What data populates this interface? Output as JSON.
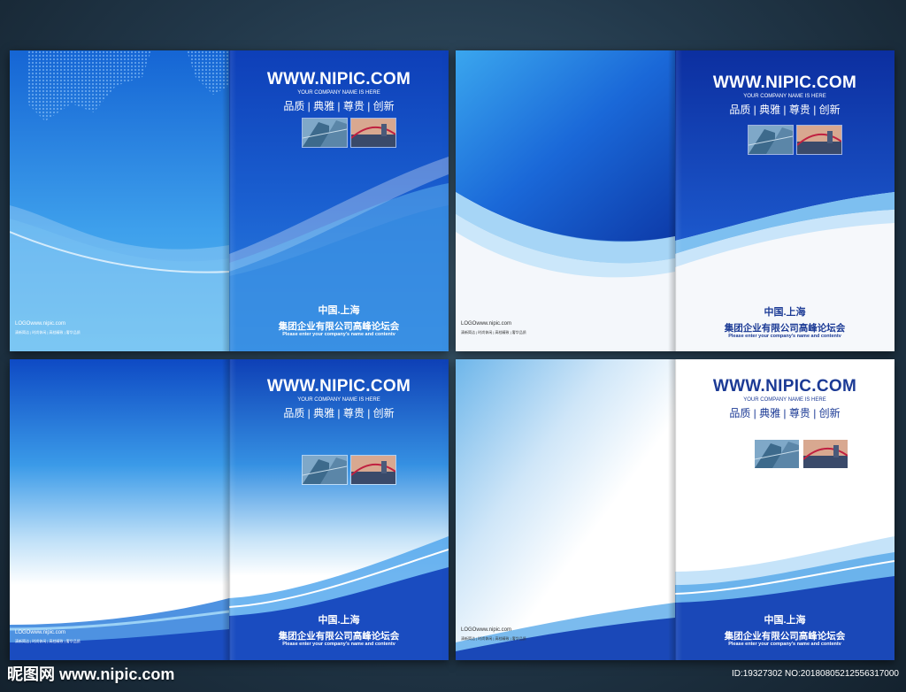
{
  "brochure": {
    "url": "WWW.NIPIC.COM",
    "tagline": "YOUR COMPANY NAME IS HERE",
    "slogan": "品质 | 典雅 | 尊贵 | 创新",
    "city": "中国.上海",
    "company": "集团企业有限公司高峰论坛会",
    "enter": "Please enter your company's name and contentv",
    "logo": "LOGOwww.nipic.com",
    "logo_sub": "清新简洁 | 时尚休闲 | 高档精致 | 奢华品质",
    "colors": {
      "accent_blue": "#1a4fc4",
      "navy": "#1b3a95",
      "sky": "#4ea8ea"
    }
  },
  "watermark": {
    "left": "昵图网 www.nipic.com",
    "right": "ID:19327302 NO:20180805212556317000"
  }
}
